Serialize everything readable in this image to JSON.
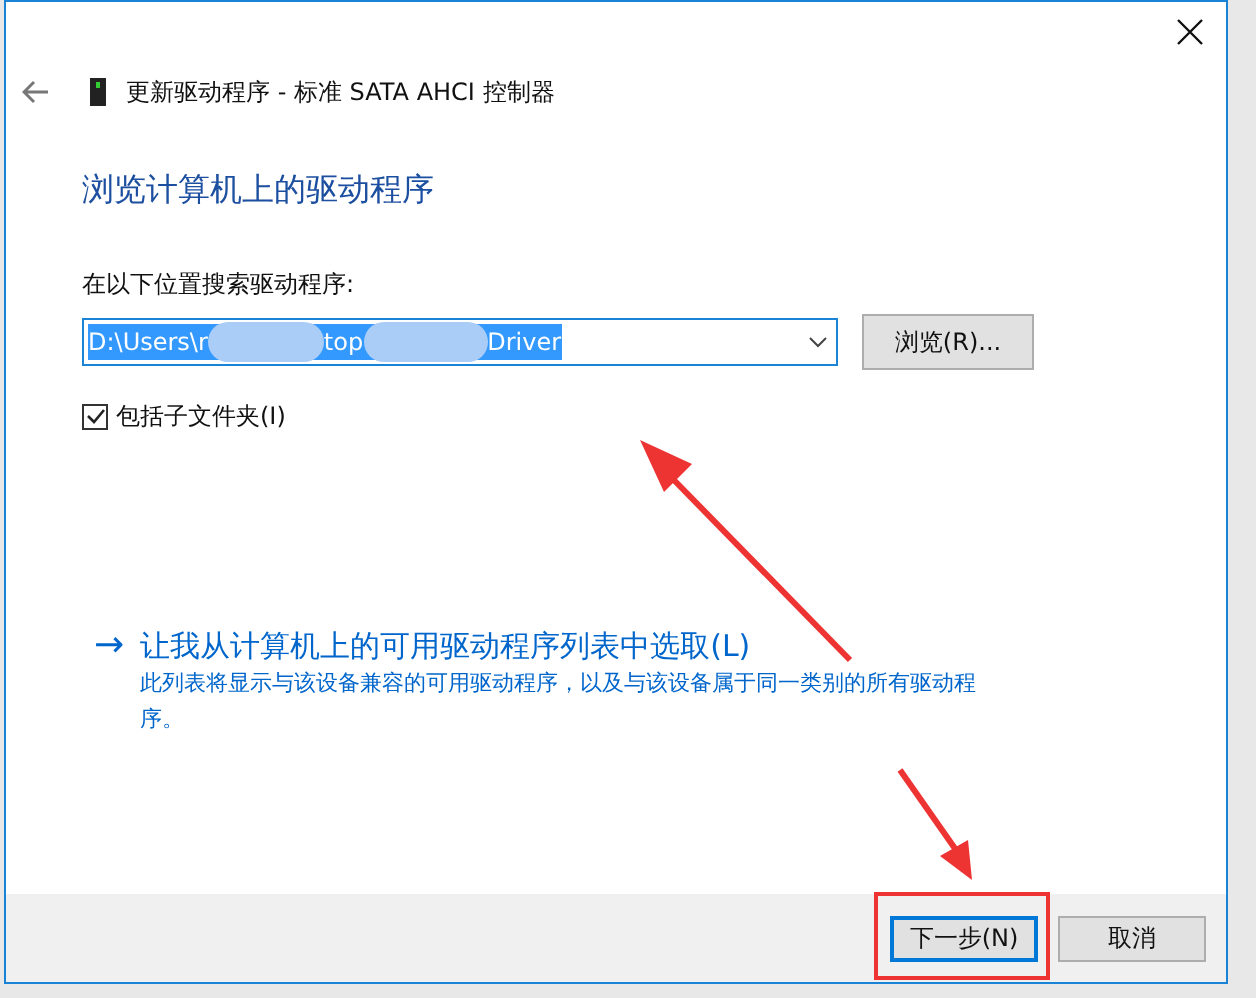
{
  "window": {
    "title": "更新驱动程序 - 标准 SATA AHCI 控制器"
  },
  "heading": "浏览计算机上的驱动程序",
  "search_label": "在以下位置搜索驱动程序:",
  "path_field": {
    "value_parts": [
      "D:\\Users\\r",
      "top",
      "Driver"
    ],
    "selected": true
  },
  "browse_button": "浏览(R)...",
  "include_subfolders": {
    "label": "包括子文件夹(I)",
    "checked": true
  },
  "pick_link": {
    "arrow": "→",
    "label": "让我从计算机上的可用驱动程序列表中选取(L)",
    "description": "此列表将显示与该设备兼容的可用驱动程序，以及与该设备属于同一类别的所有驱动程序。"
  },
  "buttons": [
    {
      "label": "下一步(N)",
      "default": true,
      "highlighted": true
    },
    {
      "label": "取消",
      "default": false,
      "highlighted": false
    }
  ]
}
